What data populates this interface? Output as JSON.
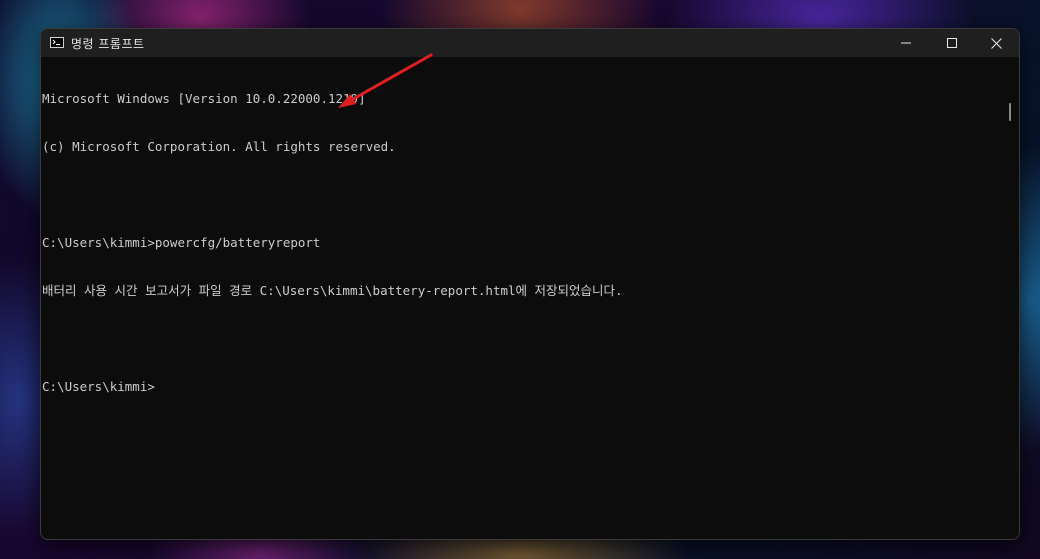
{
  "window": {
    "title": "명령 프롬프트"
  },
  "controls": {
    "minimize_icon": "minimize-icon",
    "maximize_icon": "maximize-icon",
    "close_icon": "close-icon"
  },
  "console": {
    "lines": [
      "Microsoft Windows [Version 10.0.22000.1219]",
      "(c) Microsoft Corporation. All rights reserved.",
      "",
      "C:\\Users\\kimmi>powercfg/batteryreport",
      "배터리 사용 시간 보고서가 파일 경로 C:\\Users\\kimmi\\battery-report.html에 저장되었습니다.",
      "",
      "C:\\Users\\kimmi>"
    ]
  },
  "colors": {
    "console_bg": "#0c0c0c",
    "console_text": "#cccccc",
    "titlebar_bg": "#1f1f1f",
    "annotation_arrow": "#e02020"
  }
}
